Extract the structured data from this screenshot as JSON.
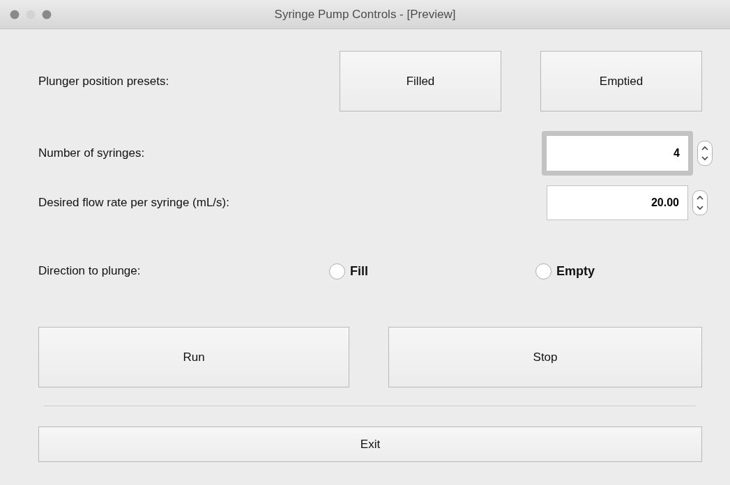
{
  "window": {
    "title": "Syringe Pump Controls - [Preview]"
  },
  "presets": {
    "label": "Plunger position presets:",
    "buttons": [
      "Filled",
      "Emptied"
    ]
  },
  "fields": [
    {
      "label": "Number of syringes:",
      "value": "4",
      "focused": true
    },
    {
      "label": "Desired flow rate per syringe (mL/s):",
      "value": "20.00",
      "focused": false
    }
  ],
  "direction": {
    "label": "Direction to plunge:",
    "options": [
      {
        "label": "Fill",
        "selected": false
      },
      {
        "label": "Empty",
        "selected": false
      }
    ]
  },
  "actions": [
    "Run",
    "Stop"
  ],
  "exit_button": "Exit"
}
